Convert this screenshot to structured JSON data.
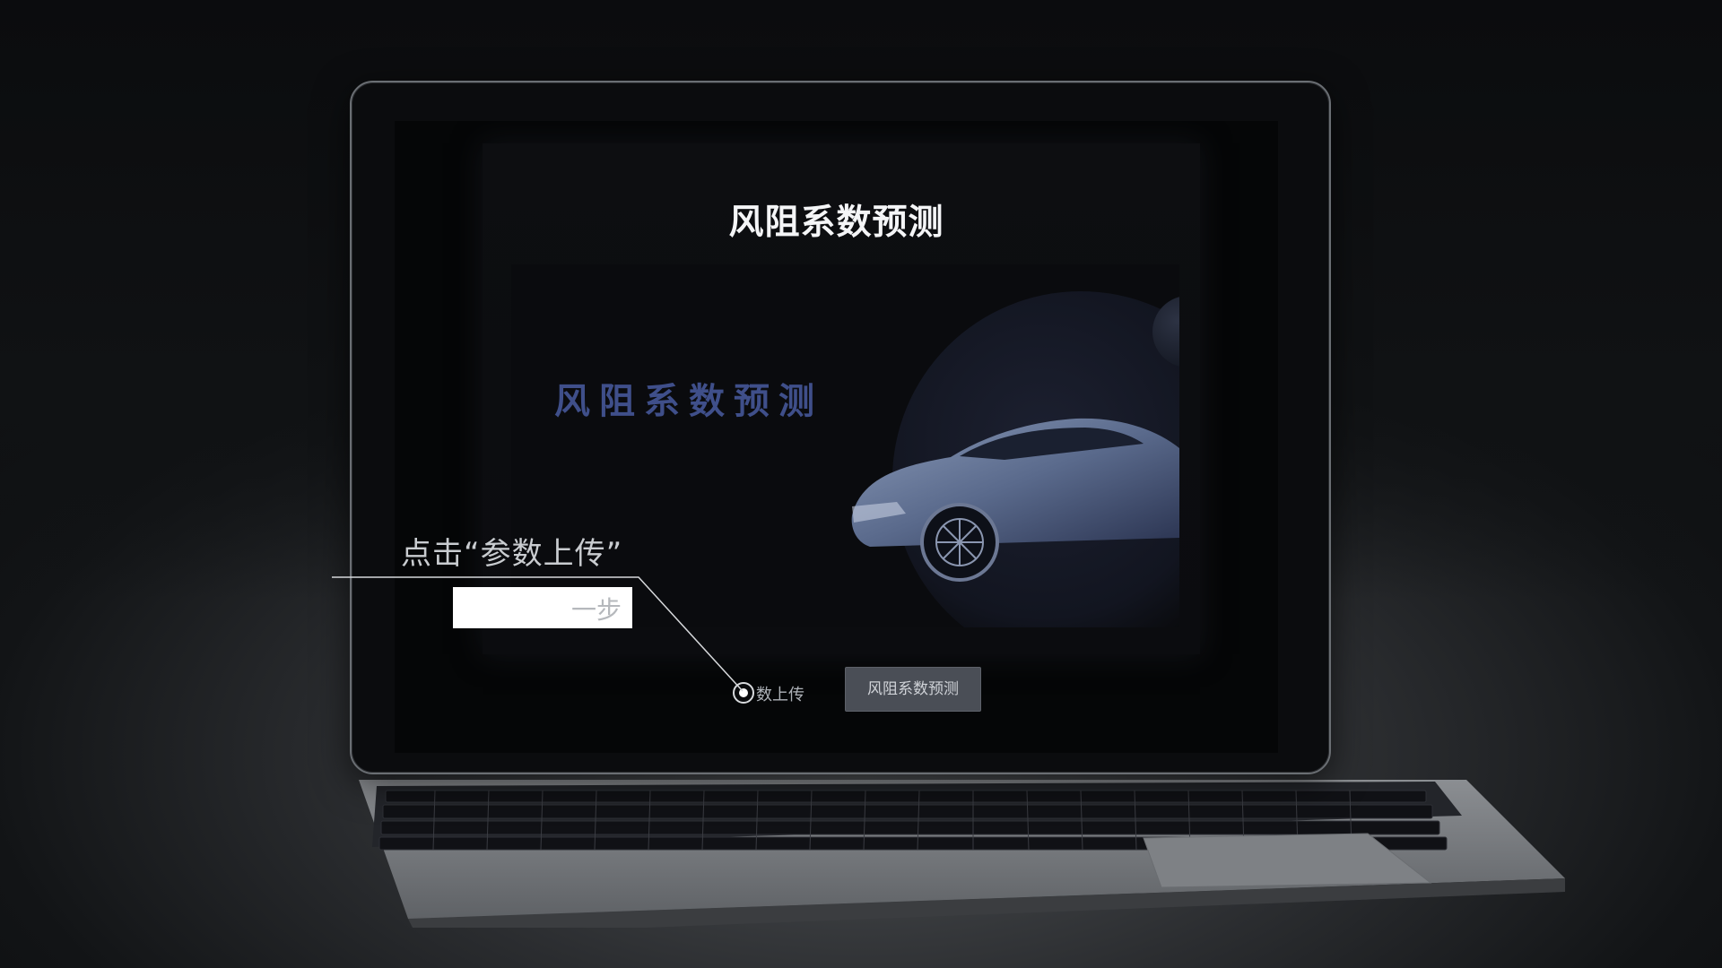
{
  "app": {
    "title": "风阻系数预测",
    "hero_title": "风阻系数预测",
    "upload_label": "数上传",
    "predict_button": "风阻系数预测"
  },
  "callout": {
    "instruction": "点击“参数上传”",
    "box_text": "一步"
  },
  "colors": {
    "accent_hero_text": "#3f4f8a",
    "button_bg": "#4a4e56",
    "background": "#0a0b0d"
  },
  "icons": [
    "radio-dot-icon",
    "car-image"
  ]
}
